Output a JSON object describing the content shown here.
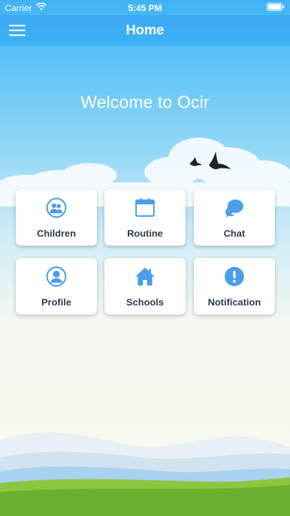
{
  "status_bar": {
    "carrier": "Carrier",
    "time": "5:45 PM"
  },
  "nav": {
    "title": "Home",
    "menu_icon": "hamburger-menu-icon"
  },
  "welcome": "Welcome to Ocir",
  "colors": {
    "accent": "#3aa9f2",
    "icon_blue": "#4a9fe8",
    "label_text": "#2d3a4a"
  },
  "tiles": [
    {
      "label": "Children",
      "icon": "children-icon"
    },
    {
      "label": "Routine",
      "icon": "calendar-icon"
    },
    {
      "label": "Chat",
      "icon": "chat-icon"
    },
    {
      "label": "Profile",
      "icon": "profile-icon"
    },
    {
      "label": "Schools",
      "icon": "home-icon"
    },
    {
      "label": "Notification",
      "icon": "notification-icon"
    }
  ]
}
